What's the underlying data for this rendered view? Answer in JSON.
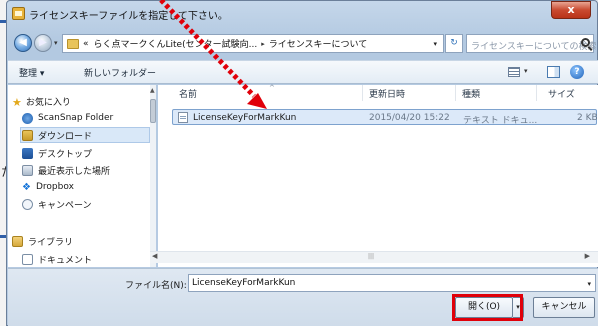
{
  "background": {
    "kana_fragment": "た"
  },
  "dialog": {
    "title": "ライセンスキーファイルを指定して下さい。",
    "close_symbol": "x"
  },
  "address": {
    "back_icon": "back-arrow-icon",
    "forward_icon": "forward-arrow-icon",
    "prefix": "«",
    "crumbs": [
      "らく点マークくんLite(センター試験向...",
      "ライセンスキーについて"
    ],
    "crumb_separator": "▸",
    "search_placeholder": "ライセンスキーについての検索"
  },
  "toolbar": {
    "organize_label": "整理 ▾",
    "new_folder_label": "新しいフォルダー",
    "help_symbol": "?"
  },
  "nav": {
    "items": [
      {
        "label": "お気に入り",
        "icon": "star-icon"
      },
      {
        "label": "ScanSnap Folder",
        "icon": "scansnap-icon"
      },
      {
        "label": "ダウンロード",
        "icon": "download-folder-icon"
      },
      {
        "label": "デスクトップ",
        "icon": "desktop-icon"
      },
      {
        "label": "最近表示した場所",
        "icon": "recent-places-icon"
      },
      {
        "label": "Dropbox",
        "icon": "dropbox-icon"
      },
      {
        "label": "キャンペーン",
        "icon": "campaign-icon"
      },
      {
        "label": "ライブラリ",
        "icon": "library-icon"
      },
      {
        "label": "ドキュメント",
        "icon": "documents-icon"
      }
    ]
  },
  "file_list": {
    "columns": [
      "名前",
      "更新日時",
      "種類",
      "サイズ"
    ],
    "rows": [
      {
        "name": "LicenseKeyForMarkKun",
        "modified": "2015/04/20 15:22",
        "type": "テキスト ドキュ...",
        "size": "2 KB"
      }
    ]
  },
  "bottom": {
    "filename_label": "ファイル名(N):",
    "filename_value": "LicenseKeyForMarkKun",
    "open_label": "開く(O)",
    "cancel_label": "キャンセル"
  },
  "colors": {
    "highlight": "#e0000a",
    "arrow": "#e0000a"
  }
}
